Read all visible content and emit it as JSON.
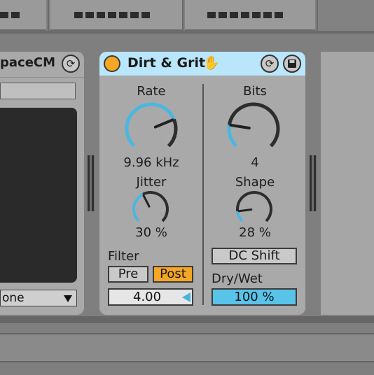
{
  "colors": {
    "header_bg": "#b9e6fb",
    "device_bg": "#a9a9a9",
    "knob_accent": "#4bb7e0",
    "power_on": "#f5a623",
    "post_active": "#f6a524",
    "drywet_fill": "#58c4ea",
    "hot_swap_hand": "#2555d8"
  },
  "left_device": {
    "title": "paceCM",
    "dropdown_value": "one",
    "icons": [
      "hot-swap-icon",
      "chevron-down-icon"
    ]
  },
  "device": {
    "title": "Dirt & Grit",
    "icons": [
      "power-icon",
      "hand-icon",
      "hot-swap-icon",
      "save-icon"
    ],
    "knobs": {
      "rate": {
        "label": "Rate",
        "value": "9.96 kHz",
        "normalized": 0.75
      },
      "jitter": {
        "label": "Jitter",
        "value": "30 %",
        "normalized": 0.4
      },
      "bits": {
        "label": "Bits",
        "value": "4",
        "normalized": 0.2
      },
      "shape": {
        "label": "Shape",
        "value": "28 %",
        "normalized": 0.14
      }
    },
    "filter": {
      "label": "Filter",
      "pre_label": "Pre",
      "post_label": "Post",
      "selected": "Post",
      "freq_value": "4.00"
    },
    "dc_shift_label": "DC Shift",
    "drywet": {
      "label": "Dry/Wet",
      "value": "100 %"
    }
  }
}
